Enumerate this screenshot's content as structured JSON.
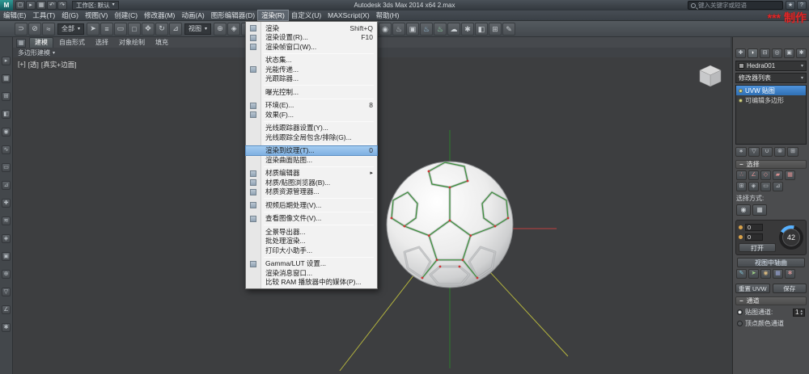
{
  "titlebar": {
    "logo": "M",
    "workspace": "工作区: 默认",
    "title": "Autodesk 3ds Max 2014 x64    2.max",
    "search_placeholder": "键入关键字或短语",
    "quick_icons": [
      {
        "name": "new-file-icon",
        "g": "▢"
      },
      {
        "name": "open-file-icon",
        "g": "▸"
      },
      {
        "name": "save-file-icon",
        "g": "▦"
      },
      {
        "name": "undo-icon",
        "g": "↶"
      },
      {
        "name": "redo-icon",
        "g": "↷"
      }
    ],
    "right_icons": [
      {
        "name": "favorites-icon",
        "g": "★"
      },
      {
        "name": "help-icon",
        "g": "?"
      }
    ],
    "watermark_stars": "***",
    "watermark_text": "制作"
  },
  "menubar": {
    "items": [
      {
        "label": "编辑(E)"
      },
      {
        "label": "工具(T)"
      },
      {
        "label": "组(G)"
      },
      {
        "label": "视图(V)"
      },
      {
        "label": "创建(C)"
      },
      {
        "label": "修改器(M)"
      },
      {
        "label": "动画(A)"
      },
      {
        "label": "图形编辑器(D)"
      },
      {
        "label": "渲染(R)",
        "active": true
      },
      {
        "label": "自定义(U)"
      },
      {
        "label": "MAXScript(X)"
      },
      {
        "label": "帮助(H)"
      }
    ]
  },
  "render_menu": {
    "items": [
      {
        "label": "渲染",
        "shortcut": "Shift+Q",
        "icon": true
      },
      {
        "label": "渲染设置(R)...",
        "shortcut": "F10",
        "icon": true
      },
      {
        "label": "渲染帧窗口(W)...",
        "icon": true
      },
      {
        "sep": true
      },
      {
        "label": "状态集..."
      },
      {
        "label": "光能传递...",
        "icon": true
      },
      {
        "label": "光跟踪器..."
      },
      {
        "sep": true
      },
      {
        "label": "曝光控制..."
      },
      {
        "sep": true
      },
      {
        "label": "环境(E)...",
        "shortcut": "8",
        "icon": true
      },
      {
        "label": "效果(F)...",
        "icon": true
      },
      {
        "sep": true
      },
      {
        "label": "光线跟踪器设置(Y)..."
      },
      {
        "label": "光线跟踪全局包含/排除(G)..."
      },
      {
        "sep": true
      },
      {
        "label": "渲染到纹理(T)...",
        "shortcut": "0",
        "highlight": true
      },
      {
        "label": "渲染曲面贴图..."
      },
      {
        "sep": true
      },
      {
        "label": "材质编辑器",
        "submenu": true,
        "icon": true
      },
      {
        "label": "材质/贴图浏览器(B)...",
        "icon": true
      },
      {
        "label": "材质资源管理器...",
        "icon": true
      },
      {
        "sep": true
      },
      {
        "label": "视频后期处理(V)...",
        "icon": true
      },
      {
        "sep": true
      },
      {
        "label": "查看图像文件(V)...",
        "icon": true
      },
      {
        "sep": true
      },
      {
        "label": "全景导出器..."
      },
      {
        "label": "批处理渲染..."
      },
      {
        "label": "打印大小助手..."
      },
      {
        "sep": true
      },
      {
        "label": "Gamma/LUT 设置...",
        "icon": true
      },
      {
        "label": "渲染消息窗口..."
      },
      {
        "label": "比较 RAM 播放器中的媒体(P)..."
      }
    ]
  },
  "toolbar": {
    "filter_dropdown": "全部",
    "coord_dropdown": "视图",
    "left_icons": [
      {
        "name": "select-link-icon",
        "g": "⊃"
      },
      {
        "name": "unlink-icon",
        "g": "⊘"
      },
      {
        "name": "bind-spacewarp-icon",
        "g": "≈"
      },
      {
        "name": "selection-filter-dropdown",
        "dropdown": "filter"
      },
      {
        "name": "select-object-icon",
        "g": "➤"
      },
      {
        "name": "select-by-name-icon",
        "g": "≡"
      },
      {
        "name": "rect-region-icon",
        "g": "▭"
      },
      {
        "name": "window-crossing-icon",
        "g": "□"
      },
      {
        "name": "select-move-icon",
        "g": "✥"
      },
      {
        "name": "select-rotate-icon",
        "g": "↻"
      },
      {
        "name": "select-scale-icon",
        "g": "⊿"
      },
      {
        "name": "ref-coord-dropdown",
        "dropdown": "coord"
      },
      {
        "name": "use-pivot-icon",
        "g": "⊕"
      },
      {
        "name": "select-manipulate-icon",
        "g": "◈"
      },
      {
        "name": "snap-toggle-icon",
        "g": "3",
        "tint": "#9ecbe8"
      },
      {
        "name": "angle-snap-icon",
        "g": "∠"
      },
      {
        "name": "percent-snap-icon",
        "g": "%"
      },
      {
        "name": "spinner-snap-icon",
        "g": "⇅"
      },
      {
        "name": "named-selection-icon",
        "g": "{"
      },
      {
        "name": "mirror-icon",
        "g": "⋈"
      },
      {
        "name": "align-icon",
        "g": "≣"
      },
      {
        "name": "layer-manager-icon",
        "g": "≋"
      },
      {
        "name": "graphite-toggle-icon",
        "g": "▦"
      },
      {
        "name": "curve-editor-icon",
        "g": "∿"
      },
      {
        "name": "schematic-view-icon",
        "g": "#"
      }
    ],
    "right_icons": [
      {
        "name": "material-editor-icon",
        "g": "◉"
      },
      {
        "name": "render-setup-icon",
        "g": "♨"
      },
      {
        "name": "rendered-frame-icon",
        "g": "▣"
      },
      {
        "name": "render-production-icon",
        "g": "♨",
        "tint": "#9ecbe8"
      },
      {
        "name": "render-iterative-icon",
        "g": "♨",
        "tint": "#9ee8b4"
      },
      {
        "name": "render-in-cloud-icon",
        "g": "☁"
      },
      {
        "name": "open-gallery-icon",
        "g": "✱"
      },
      {
        "name": "lighting-analysis-icon",
        "g": "◧"
      },
      {
        "name": "composite-icon",
        "g": "⊞"
      },
      {
        "name": "script-listener-icon",
        "g": "✎"
      }
    ]
  },
  "ribbon": {
    "tabs": [
      "建模",
      "自由形式",
      "选择",
      "对象绘制",
      "填充"
    ],
    "active_tab": "建模",
    "panel_button": "多边形建模"
  },
  "left_strip": {
    "icons": [
      "▸",
      "▦",
      "⊞",
      "◧",
      "◉",
      "∿",
      "▭",
      "⊿",
      "✚",
      "≋",
      "◈",
      "▣",
      "⊕",
      "▽",
      "∠",
      "✱"
    ]
  },
  "viewport": {
    "label_plus": "[+]",
    "label_view": "[透]",
    "label_shading": "[真实+边面]"
  },
  "command_panel": {
    "tabs": [
      {
        "name": "tab-create-icon",
        "g": "✚"
      },
      {
        "name": "tab-modify-icon",
        "g": "◗",
        "active": true
      },
      {
        "name": "tab-hierarchy-icon",
        "g": "⊟"
      },
      {
        "name": "tab-motion-icon",
        "g": "◎"
      },
      {
        "name": "tab-display-icon",
        "g": "▣"
      },
      {
        "name": "tab-utilities-icon",
        "g": "✱"
      }
    ],
    "object_name": "Hedra001",
    "modifier_list_label": "修改器列表",
    "stack": [
      {
        "label": "UVW 贴图",
        "selected": true
      },
      {
        "label": "可编辑多边形",
        "selected": false
      }
    ],
    "stack_tools": [
      {
        "name": "pin-stack-icon",
        "g": "∗"
      },
      {
        "name": "show-end-result-icon",
        "g": "▽"
      },
      {
        "name": "make-unique-icon",
        "g": "∪"
      },
      {
        "name": "remove-modifier-icon",
        "g": "⊗"
      },
      {
        "name": "configure-sets-icon",
        "g": "⊞"
      }
    ],
    "selection": {
      "title": "选择",
      "subobject_icons_row1": [
        "∴",
        "∠",
        "◇",
        "▰",
        "▦"
      ],
      "subobject_icons_row2": [
        "⊞",
        "◈",
        "▭",
        "⊿"
      ],
      "select_by_label": "选择方式:",
      "select_by_icons": [
        "◉",
        "▦"
      ]
    },
    "tool_box": {
      "value1": "0",
      "value2": "0",
      "dial_value": "42",
      "open_button": "打开",
      "align_button": "视图中轴曲"
    },
    "paint_icons": [
      {
        "g": "✎",
        "tint": "#7fc4d9"
      },
      {
        "g": "➤",
        "tint": "#9fd486"
      },
      {
        "g": "◉",
        "tint": "#d9b97f"
      },
      {
        "g": "▦",
        "tint": "#9aa7d9"
      },
      {
        "g": "✱",
        "tint": "#c98f8f"
      }
    ],
    "channel": {
      "reset_button": "重置 UVW",
      "save_button": "保存",
      "title": "通道",
      "map_channel_label": "贴图通道:",
      "map_channel_value": "1",
      "vertex_color_label": "顶点颜色通道"
    }
  }
}
